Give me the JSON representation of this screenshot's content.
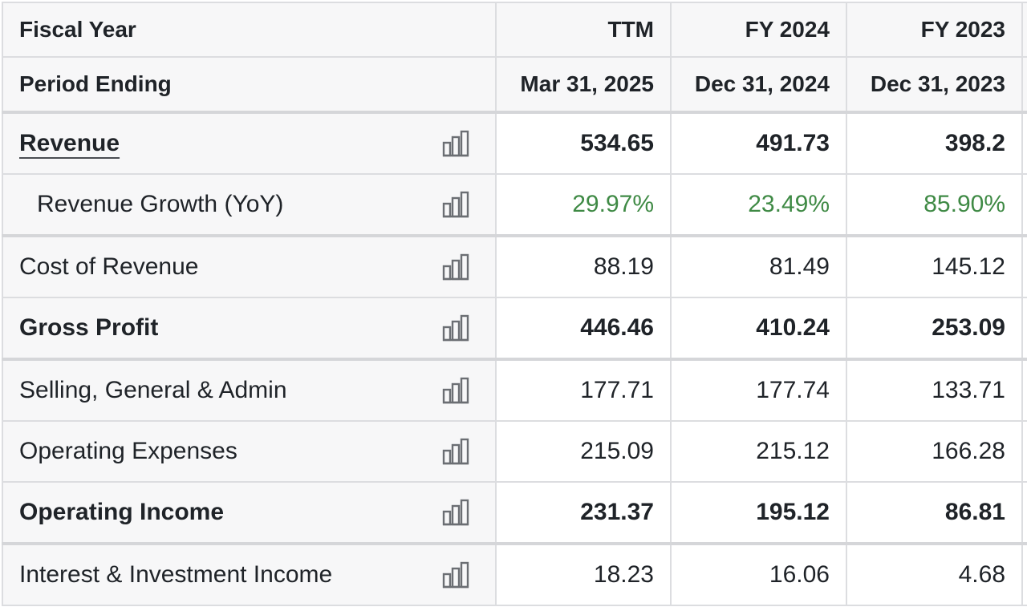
{
  "columns": {
    "fiscal_year_label": "Fiscal Year",
    "period_ending_label": "Period Ending",
    "periods": [
      {
        "fiscal_year": "TTM",
        "period_ending": "Mar 31, 2025"
      },
      {
        "fiscal_year": "FY 2024",
        "period_ending": "Dec 31, 2024"
      },
      {
        "fiscal_year": "FY 2023",
        "period_ending": "Dec 31, 2023"
      }
    ]
  },
  "rows": [
    {
      "label": "Revenue",
      "values": [
        "534.65",
        "491.73",
        "398.2"
      ]
    },
    {
      "label": "Revenue Growth (YoY)",
      "values": [
        "29.97%",
        "23.49%",
        "85.90%"
      ]
    },
    {
      "label": "Cost of Revenue",
      "values": [
        "88.19",
        "81.49",
        "145.12"
      ]
    },
    {
      "label": "Gross Profit",
      "values": [
        "446.46",
        "410.24",
        "253.09"
      ]
    },
    {
      "label": "Selling, General & Admin",
      "values": [
        "177.71",
        "177.74",
        "133.71"
      ]
    },
    {
      "label": "Operating Expenses",
      "values": [
        "215.09",
        "215.12",
        "166.28"
      ]
    },
    {
      "label": "Operating Income",
      "values": [
        "231.37",
        "195.12",
        "86.81"
      ]
    },
    {
      "label": "Interest & Investment Income",
      "values": [
        "18.23",
        "16.06",
        "4.68"
      ]
    }
  ],
  "icons": {
    "row_chart": "bar-chart-icon"
  },
  "colors": {
    "positive_growth": "#3f8a45",
    "label_background": "#f7f7f8",
    "grid_line": "#dcdde0"
  }
}
